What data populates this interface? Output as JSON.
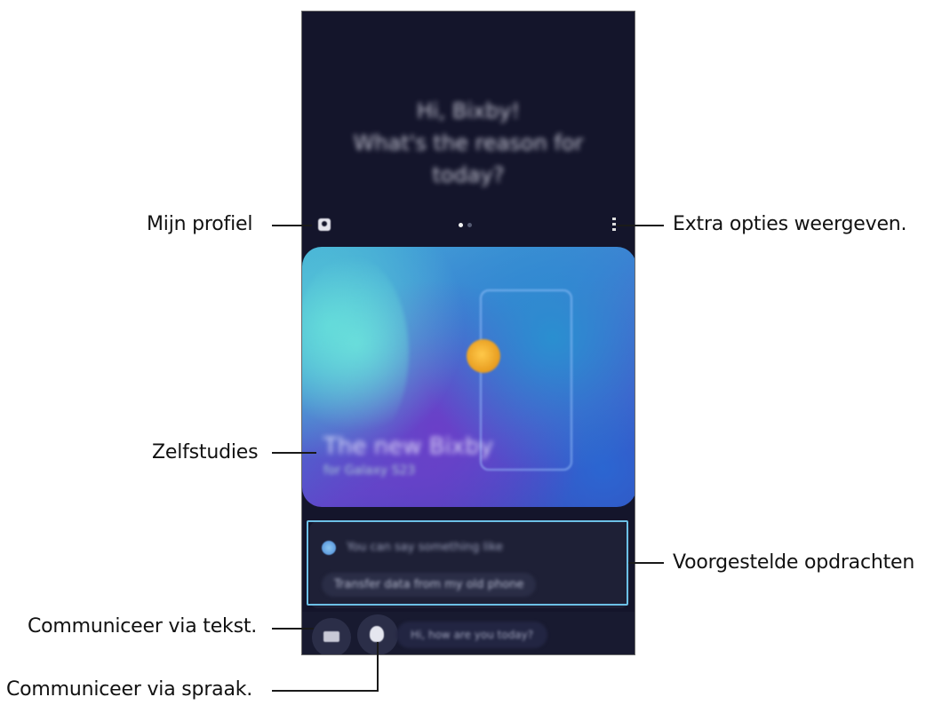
{
  "callouts": {
    "profile": "Mijn profiel",
    "more_options": "Extra opties weergeven.",
    "tutorials": "Zelfstudies",
    "suggested_commands": "Voorgestelde opdrachten",
    "text_input": "Communiceer via tekst.",
    "voice_input": "Communiceer via spraak."
  },
  "screen": {
    "greeting_lines": [
      "Hi, Bixby!",
      "What's the reason for",
      "today?"
    ],
    "tutorial_card": {
      "title": "The new Bixby",
      "subtitle": "for Galaxy S23"
    },
    "suggestions": {
      "prompt": "You can say something like",
      "chip": "Transfer data from my old phone"
    },
    "voice_hint": "Hi, how are you today?"
  },
  "colors": {
    "screen_background": "#14152b",
    "highlight_frame": "#6cc0e6"
  }
}
